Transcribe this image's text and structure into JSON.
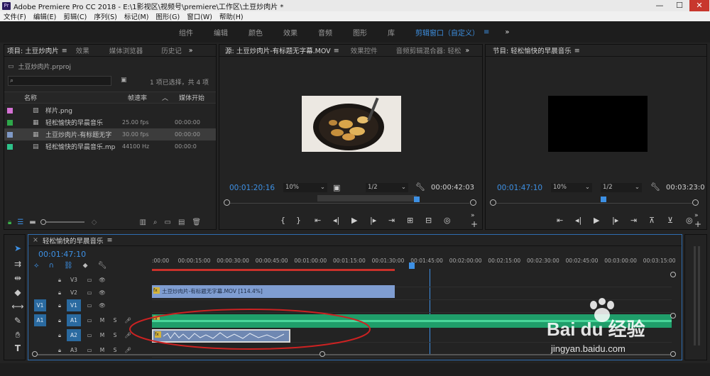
{
  "window": {
    "title": "Adobe Premiere Pro CC 2018 - E:\\1影视区\\视频号\\premiere\\工作区\\土豆炒肉片 *",
    "min": "—",
    "max": "☐",
    "close": "✕"
  },
  "menu": [
    "文件(F)",
    "编辑(E)",
    "剪辑(C)",
    "序列(S)",
    "标记(M)",
    "图形(G)",
    "窗口(W)",
    "帮助(H)"
  ],
  "workspaces": [
    "组件",
    "编辑",
    "颜色",
    "效果",
    "音频",
    "图形",
    "库",
    "剪辑窗口（自定义）"
  ],
  "workspace_more": "≡",
  "workspace_chevron": "»",
  "project": {
    "tabs": [
      "项目: 土豆炒肉片",
      "效果",
      "媒体浏览器",
      "历史记"
    ],
    "file": "土豆炒肉片.prproj",
    "search_placeholder": "",
    "selection": "1 项已选择，共 4 项",
    "col_name": "名称",
    "col_fps": "帧速率",
    "col_start": "媒体开始",
    "items": [
      {
        "name": "样片.png",
        "fps": "",
        "start": "",
        "color": "#d472d4"
      },
      {
        "name": "轻松愉快的早晨音乐",
        "fps": "25.00 fps",
        "start": "00:00:00",
        "color": "#2ea84a"
      },
      {
        "name": "土豆炒肉片-有标题无字",
        "fps": "30.00 fps",
        "start": "00:00:00",
        "color": "#7f99c6"
      },
      {
        "name": "轻松愉快的早晨音乐.mp",
        "fps": "44100 Hz",
        "start": "00:00:0",
        "color": "#2ec28a"
      }
    ]
  },
  "source": {
    "tabs": [
      "源: 土豆炒肉片-有标题无字幕.MOV",
      "效果控件",
      "音频剪辑混合器: 轻松"
    ],
    "tc_left": "00:01:20:16",
    "zoom": "10%",
    "res": "1/2",
    "tc_right": "00:00:42:03"
  },
  "program": {
    "tab": "节目: 轻松愉快的早晨音乐",
    "tc_left": "00:01:47:10",
    "zoom": "10%",
    "res": "1/2",
    "tc_right": "00:03:23:0"
  },
  "timeline": {
    "tab": "轻松愉快的早晨音乐",
    "timecode": "00:01:47:10",
    "ruler": [
      ":00:00",
      "00:00:15:00",
      "00:00:30:00",
      "00:00:45:00",
      "00:01:00:00",
      "00:01:15:00",
      "00:01:30:00",
      "00:01:45:00",
      "00:02:00:00",
      "00:02:15:00",
      "00:02:30:00",
      "00:02:45:00",
      "00:03:00:00",
      "00:03:15:00"
    ],
    "video_tracks": [
      "V3",
      "V2",
      "V1"
    ],
    "audio_tracks": [
      "A1",
      "A2",
      "A3"
    ],
    "v1_src": "V1",
    "a1_src": "A1",
    "clip_v2": "土豆炒肉片-有标题无字幕.MOV [114.4%]",
    "fx": "fx",
    "m": "M",
    "s": "S"
  },
  "watermark": {
    "brand": "Bai du 经验",
    "url": "jingyan.baidu.com"
  },
  "colors": {
    "accent": "#3d90e4",
    "video_clip": "#7f9dd1",
    "audio_clip": "#1f9e6a",
    "playhead": "#3d90e4",
    "annotation": "#cc2222"
  }
}
